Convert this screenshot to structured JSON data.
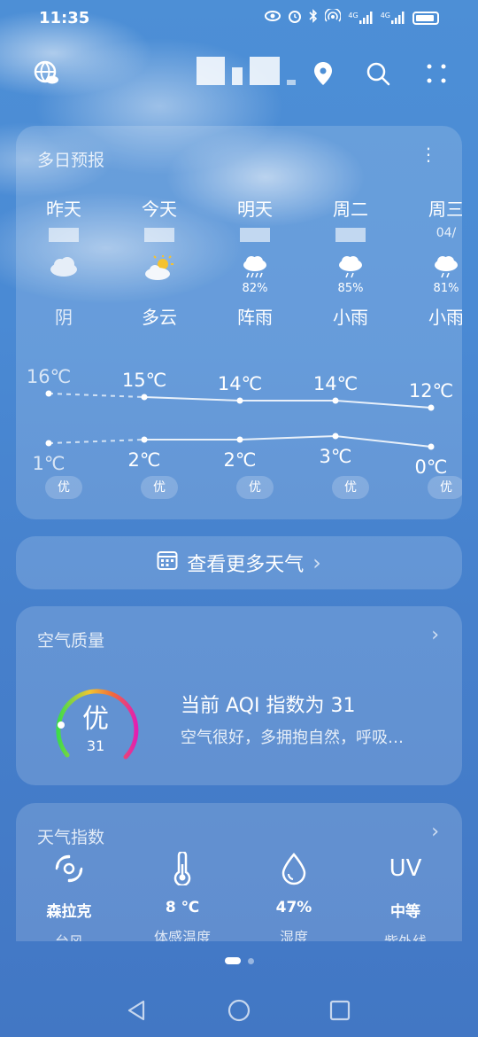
{
  "status_bar": {
    "time": "11:35",
    "network_1": "4G",
    "network_2": "4G",
    "icons": [
      "eye-icon",
      "alarm-icon",
      "bluetooth-icon",
      "hotspot-icon",
      "signal-icon",
      "signal-icon",
      "battery-icon"
    ]
  },
  "top_bar": {
    "icons": [
      "globe-cloud-icon",
      "location-pin-icon",
      "search-icon",
      "more-dots-icon"
    ]
  },
  "forecast": {
    "title": "多日预报",
    "days": [
      {
        "name": "昨天",
        "icon": "cloudy-icon",
        "prob": "",
        "weather": "阴",
        "high": "16℃",
        "low": "1℃",
        "aq": "优"
      },
      {
        "name": "今天",
        "icon": "partly-cloudy-icon",
        "prob": "",
        "weather": "多云",
        "high": "15℃",
        "low": "2℃",
        "aq": "优"
      },
      {
        "name": "明天",
        "icon": "shower-icon",
        "prob": "82%",
        "weather": "阵雨",
        "high": "14℃",
        "low": "2℃",
        "aq": "优"
      },
      {
        "name": "周二",
        "icon": "light-rain-icon",
        "prob": "85%",
        "weather": "小雨",
        "high": "14℃",
        "low": "3℃",
        "aq": "优"
      },
      {
        "name": "周三",
        "date_partial": "04/",
        "icon": "light-rain-icon",
        "prob": "81%",
        "weather": "小雨",
        "high": "12℃",
        "low": "0℃",
        "aq": "优"
      }
    ],
    "highs": [
      16,
      15,
      14,
      14,
      12
    ],
    "lows": [
      1,
      2,
      2,
      3,
      0
    ]
  },
  "more_weather": {
    "label": "查看更多天气",
    "chevron": "›"
  },
  "air_quality": {
    "title": "空气质量",
    "level": "优",
    "value": "31",
    "aqi": 31,
    "headline": "当前 AQI 指数为 31",
    "description": "空气很好，多拥抱自然，呼吸…",
    "chevron": "›"
  },
  "indices": {
    "title": "天气指数",
    "chevron": "›",
    "items": [
      {
        "icon": "typhoon-icon",
        "value": "森拉克",
        "label": "台风"
      },
      {
        "icon": "thermometer-icon",
        "value": "8 ℃",
        "label": "体感温度"
      },
      {
        "icon": "humidity-drop-icon",
        "value": "47%",
        "label": "湿度"
      },
      {
        "icon": "uv-icon",
        "icon_text": "UV",
        "value": "中等",
        "label": "紫外线"
      }
    ]
  },
  "colors": {
    "background_top": "#4d8fd6",
    "background_bottom": "#4277c4",
    "aqi_gauge_start": "#3ddc4a",
    "aqi_gauge_mid": "#f2c530",
    "aqi_gauge_end": "#e21fb2"
  }
}
